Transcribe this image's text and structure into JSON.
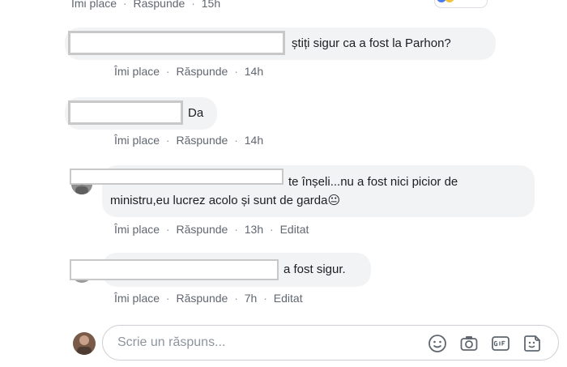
{
  "actions": {
    "like": "Îmi place",
    "reply": "Răspunde",
    "separator": "·",
    "edited": "Editat"
  },
  "top_comment": {
    "like": "Imi place",
    "reply": "Raspunde",
    "time": "15h"
  },
  "comments": [
    {
      "text": "știți sigur ca a fost la Parhon?",
      "time": "14h"
    },
    {
      "text": "Da",
      "time": "14h"
    },
    {
      "text_line1": "te înșeli...nu a fost nici picior de",
      "text_line2": "ministru,eu lucrez acolo și sunt de garda",
      "emoji": "😐",
      "time": "13h"
    },
    {
      "text": "a fost sigur.",
      "time": "7h"
    }
  ],
  "reply_box": {
    "placeholder": "Scrie un răspuns...",
    "icons": [
      "emoji-icon",
      "camera-icon",
      "gif-icon",
      "sticker-icon"
    ]
  },
  "colors": {
    "bubble": "#f2f3f5",
    "meta_text": "#606770",
    "redaction_border": "#c8c8c8"
  }
}
